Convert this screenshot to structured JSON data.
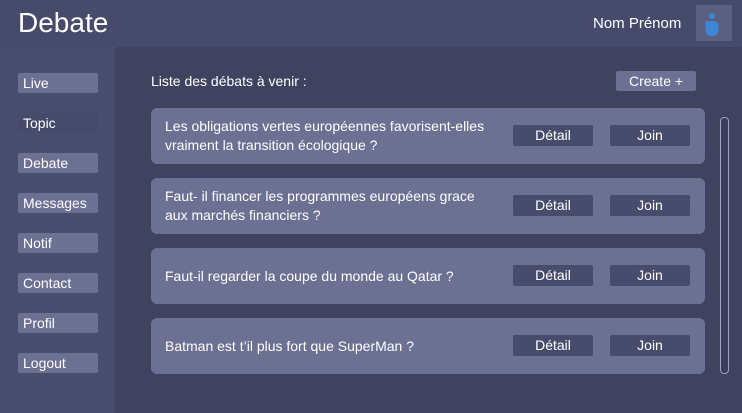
{
  "header": {
    "app_title": "Debate",
    "user_name": "Nom Prénom",
    "avatar_icon": "user-icon",
    "avatar_color": "#3d87d9"
  },
  "sidebar": {
    "items": [
      {
        "label": "Live"
      },
      {
        "label": "Topic"
      },
      {
        "label": "Debate"
      },
      {
        "label": "Messages"
      },
      {
        "label": "Notif"
      },
      {
        "label": "Contact"
      },
      {
        "label": "Profil"
      },
      {
        "label": "Logout"
      }
    ]
  },
  "main": {
    "list_title": "Liste des débats à venir :",
    "create_label": "Create +",
    "debates": [
      {
        "title": "Les obligations vertes européennes favorisent-elles vraiment la transition écologique ?",
        "detail_label": "Détail",
        "join_label": "Join"
      },
      {
        "title": "Faut- il financer les programmes européens grace aux marchés financiers ?",
        "detail_label": "Détail",
        "join_label": "Join"
      },
      {
        "title": "Faut-il regarder la coupe du monde au Qatar ?",
        "detail_label": "Détail",
        "join_label": "Join"
      },
      {
        "title": "Batman est t’il plus fort que SuperMan ?",
        "detail_label": "Détail",
        "join_label": "Join"
      }
    ]
  }
}
